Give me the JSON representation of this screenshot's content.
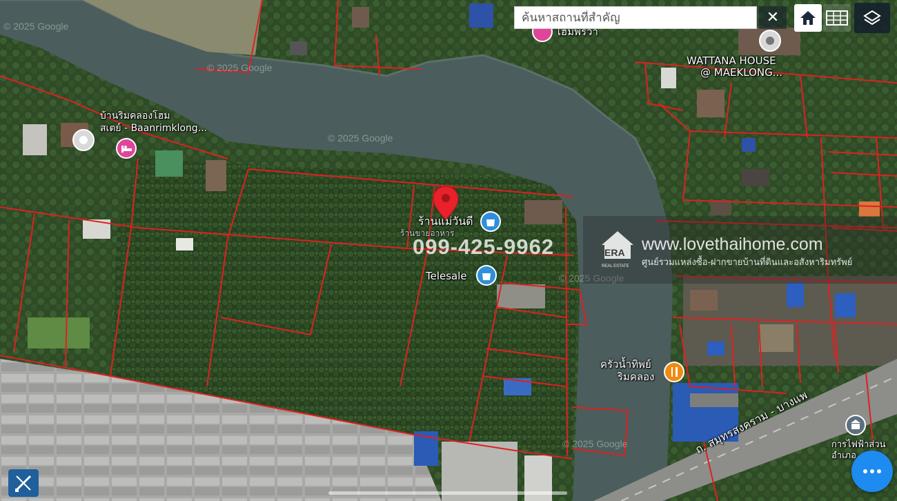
{
  "search": {
    "placeholder": "ค้นหาสถานที่สำคัญ",
    "clear_icon": "close-icon"
  },
  "toolbar": {
    "home_icon": "home-icon",
    "grid_icon": "parcel-grid-icon",
    "layers_icon": "layers-icon"
  },
  "places": {
    "homestay_name_line1": "บ้านริมคลองโฮม",
    "homestay_name_line2": "สเตย์ - Baanrimklong...",
    "wattana_line1": "WATTANA HOUSE",
    "wattana_line2": "@ MAEKLONG...",
    "top_place": "โฮมพริวา",
    "shop_name": "ร้านแม่วันดี",
    "shop_sub": "ร้านขายอาหาร",
    "telesale": "Telesale",
    "restaurant_line1": "ครัวน้ำทิพย์",
    "restaurant_line2": "ริมคลอง",
    "road": "ถ. สมุทรสงคราม - บางแพ",
    "bottom_right_line1": "การไฟฟ้าส่วน",
    "bottom_right_line2": "อำเภอ"
  },
  "watermark": {
    "phone": "099-425-9962",
    "brand": "ERA",
    "brand_sub": "REAL ESTATE",
    "url": "www.lovethaihome.com",
    "tagline": "ศูนย์รวมแหล่งซื้อ-ฝากขายบ้านที่ดินและอสังหาริมทรัพย์"
  },
  "copyright": "© 2025 Google",
  "colors": {
    "parcel_lines": "#e02020",
    "river": "#4a5c5c",
    "pin": "#e8212b",
    "chat_button": "#1d8bf0"
  }
}
